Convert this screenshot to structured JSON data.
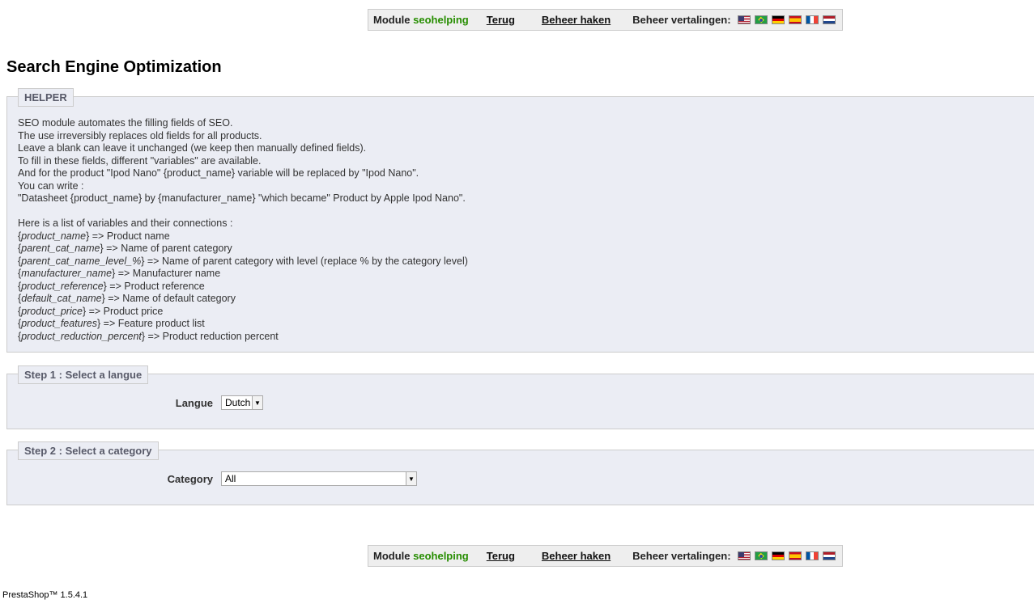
{
  "toolbar": {
    "module_prefix": "Module",
    "module_name": "seohelping",
    "back_label": "Terug",
    "hooks_label": "Beheer haken",
    "translations_label": "Beheer vertalingen:",
    "flags": [
      "en-flag-icon",
      "br-flag-icon",
      "de-flag-icon",
      "es-flag-icon",
      "fr-flag-icon",
      "nl-flag-icon"
    ]
  },
  "page": {
    "title": "Search Engine Optimization"
  },
  "helper": {
    "legend": "HELPER",
    "intro_lines": [
      "SEO module automates the filling fields of SEO.",
      "The use irreversibly replaces old fields for all products.",
      "Leave a blank can leave it unchanged (we keep then manually defined fields).",
      "To fill in these fields, different \"variables\" are available.",
      "And for the product \"Ipod Nano\" {product_name} variable will be replaced by \"Ipod Nano\".",
      "You can write :",
      "\"Datasheet {product_name} by {manufacturer_name} \"which became\" Product by Apple Ipod Nano\"."
    ],
    "variables_title": "Here is a list of variables and their connections :",
    "variables": [
      {
        "name": "product_name",
        "desc": "} => Product name"
      },
      {
        "name": "parent_cat_name",
        "desc": "} => Name of parent category"
      },
      {
        "name": "parent_cat_name_level_%",
        "desc": "} => Name of parent category with level (replace % by the category level)"
      },
      {
        "name": "manufacturer_name",
        "desc": "} => Manufacturer name"
      },
      {
        "name": "product_reference",
        "desc": "} => Product reference"
      },
      {
        "name": "default_cat_name",
        "desc": "} => Name of default category"
      },
      {
        "name": "product_price",
        "desc": "} => Product price"
      },
      {
        "name": "product_features",
        "desc": "} => Feature product list"
      },
      {
        "name": "product_reduction_percent",
        "desc": "} => Product reduction percent"
      }
    ]
  },
  "step1": {
    "legend": "Step 1 : Select a langue",
    "field_label": "Langue",
    "selected": "Dutch"
  },
  "step2": {
    "legend": "Step 2 : Select a category",
    "field_label": "Category",
    "selected": "All"
  },
  "footer": {
    "version": "PrestaShop™ 1.5.4.1"
  }
}
